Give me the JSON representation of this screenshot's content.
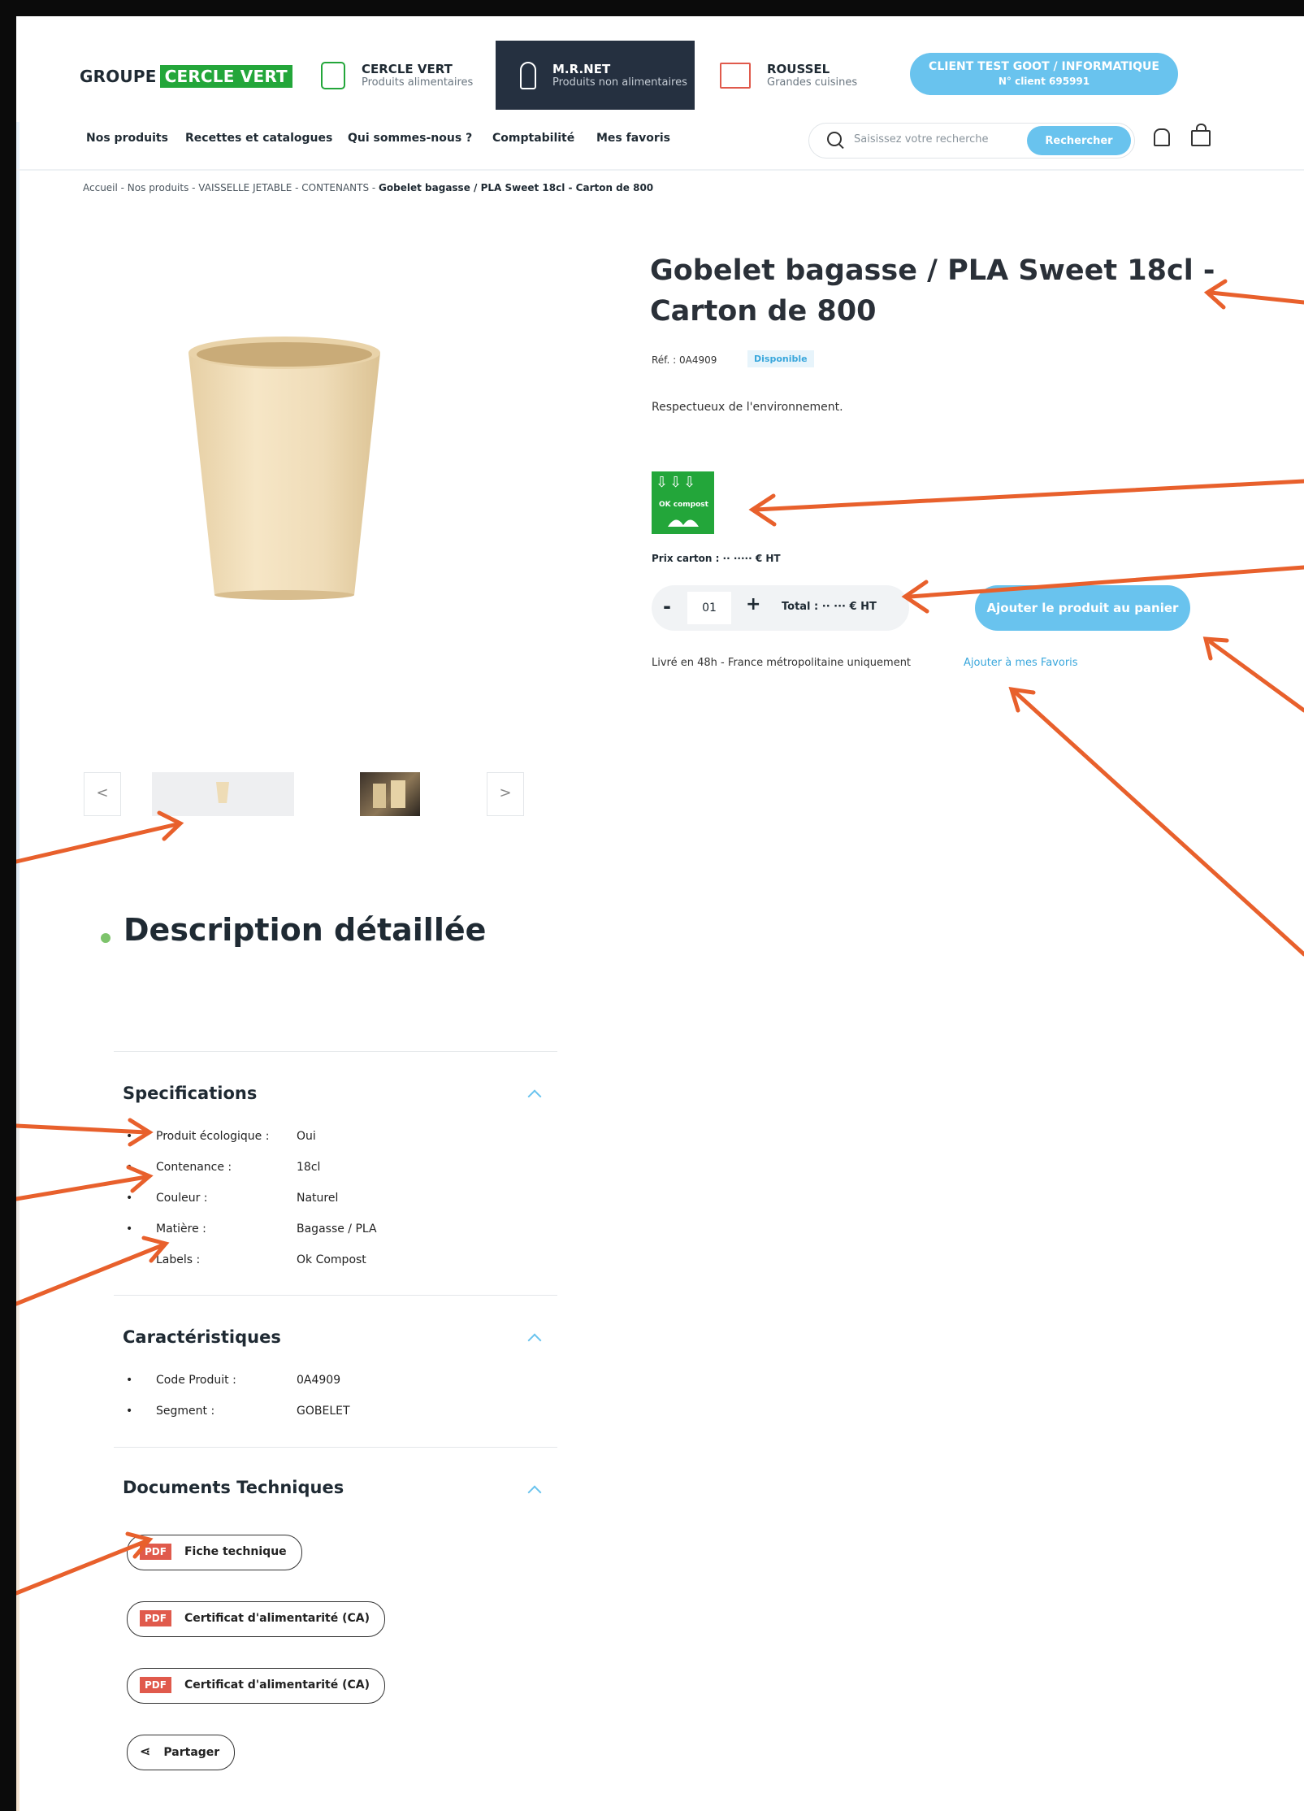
{
  "header": {
    "logo": {
      "prefix": "GROUPE",
      "highlight": "CERCLE VERT"
    },
    "brands": [
      {
        "name": "CERCLE VERT",
        "sub": "Produits alimentaires",
        "icon": "jar-icon"
      },
      {
        "name": "M.R.NET",
        "sub": "Produits non alimentaires",
        "icon": "spray-bottle-icon"
      },
      {
        "name": "ROUSSEL",
        "sub": "Grandes cuisines",
        "icon": "oven-icon"
      }
    ],
    "client": {
      "name": "CLIENT TEST GOOT / INFORMATIQUE",
      "number": "N° client 695991"
    }
  },
  "nav": {
    "items": [
      "Nos produits",
      "Recettes et catalogues",
      "Qui sommes-nous ?",
      "Comptabilité",
      "Mes favoris"
    ],
    "search_placeholder": "Saisissez votre recherche",
    "search_button": "Rechercher"
  },
  "breadcrumb": {
    "path": "Accueil  -  Nos produits  -  VAISSELLE JETABLE  -  CONTENANTS  - ",
    "current": "Gobelet bagasse / PLA Sweet 18cl - Carton de 800"
  },
  "product": {
    "title": "Gobelet bagasse / PLA Sweet 18cl - Carton de 800",
    "ref": "Réf. : 0A4909",
    "availability": "Disponible",
    "short_desc": "Respectueux de l'environnement.",
    "label_text": "OK compost",
    "price": "Prix carton : ·· ····· € HT",
    "qty_minus": "-",
    "qty": "01",
    "qty_plus": "+",
    "total": "Total :  ·· ··· € HT",
    "add_to_cart": "Ajouter le produit au panier",
    "delivery": "Livré en 48h - France métropolitaine uniquement",
    "favorite": "Ajouter à mes Favoris"
  },
  "gallery": {
    "prev": "<",
    "next": ">"
  },
  "description": {
    "heading": "Description détaillée",
    "specs": {
      "title": "Specifications",
      "rows": [
        {
          "label": "Produit écologique :",
          "value": "Oui"
        },
        {
          "label": "Contenance :",
          "value": "18cl"
        },
        {
          "label": "Couleur :",
          "value": "Naturel"
        },
        {
          "label": "Matière :",
          "value": "Bagasse / PLA"
        },
        {
          "label": "Labels :",
          "value": "Ok Compost"
        }
      ]
    },
    "features": {
      "title": "Caractéristiques",
      "rows": [
        {
          "label": "Code Produit :",
          "value": "0A4909"
        },
        {
          "label": "Segment :",
          "value": "GOBELET"
        }
      ]
    },
    "docs": {
      "title": "Documents Techniques",
      "pdf_tag": "PDF",
      "items": [
        "Fiche technique",
        "Certificat d'alimentarité (CA)",
        "Certificat d'alimentarité (CA)"
      ]
    },
    "share": "Partager",
    "bullet": "•"
  },
  "colors": {
    "accent": "#69c3ee",
    "green": "#23a63a",
    "dark": "#253040",
    "annotation": "#e8602c",
    "pdf": "#e05a4c"
  }
}
